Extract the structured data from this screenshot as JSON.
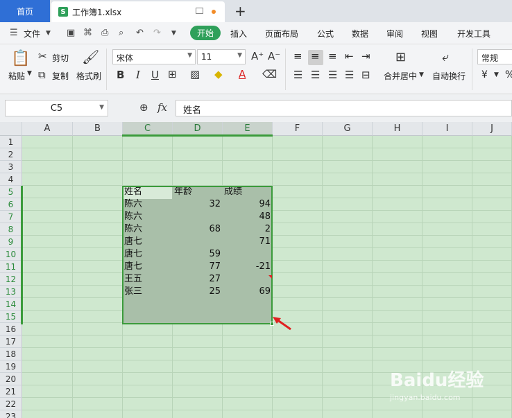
{
  "tabs": {
    "home": "首页",
    "file": "工作簿1.xlsx"
  },
  "menu": {
    "file": "文件",
    "items": [
      "开始",
      "插入",
      "页面布局",
      "公式",
      "数据",
      "审阅",
      "视图",
      "开发工具"
    ]
  },
  "ribbon": {
    "paste": "粘贴",
    "cut": "剪切",
    "copy": "复制",
    "format_painter": "格式刷",
    "font_name": "宋体",
    "font_size": "11",
    "merge_center": "合并居中",
    "wrap_text": "自动换行",
    "number_format": "常规",
    "currency": "¥",
    "percent": "%"
  },
  "formula_bar": {
    "cell_ref": "C5",
    "fx_label": "fx",
    "content": "姓名"
  },
  "sheet": {
    "columns": [
      "A",
      "B",
      "C",
      "D",
      "E",
      "F",
      "G",
      "H",
      "I",
      "J"
    ],
    "rows": [
      "1",
      "2",
      "3",
      "4",
      "5",
      "6",
      "7",
      "8",
      "9",
      "10",
      "11",
      "12",
      "13",
      "14",
      "15",
      "16",
      "17",
      "18",
      "19",
      "20",
      "21",
      "22",
      "23"
    ],
    "headers": [
      "姓名",
      "年龄",
      "成绩"
    ],
    "data": [
      {
        "name": "陈六",
        "age": "32",
        "score": "94"
      },
      {
        "name": "陈六",
        "age": "",
        "score": "48"
      },
      {
        "name": "陈六",
        "age": "68",
        "score": "2"
      },
      {
        "name": "唐七",
        "age": "",
        "score": "71"
      },
      {
        "name": "唐七",
        "age": "59",
        "score": ""
      },
      {
        "name": "唐七",
        "age": "77",
        "score": "-21"
      },
      {
        "name": "王五",
        "age": "27",
        "score": ""
      },
      {
        "name": "张三",
        "age": "25",
        "score": "69"
      }
    ]
  },
  "watermark": {
    "brand": "Baidu经验",
    "url": "jingyan.baidu.com"
  },
  "colors": {
    "accent": "#2fa05a",
    "home_tab": "#2f6fd6",
    "selection_border": "#3b9b3b",
    "sheet_bg": "#cfe8cf"
  }
}
